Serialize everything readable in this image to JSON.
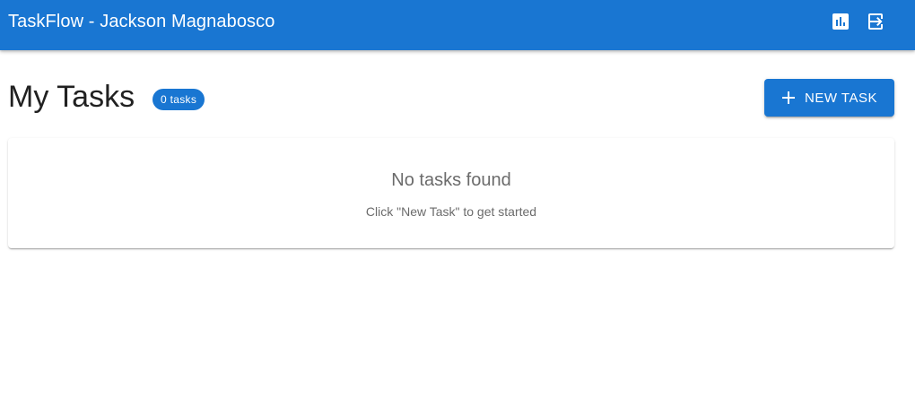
{
  "header": {
    "title": "TaskFlow - Jackson Magnabosco",
    "background": "#1976d2",
    "icons": {
      "stats": "bar-chart-icon",
      "logout": "logout-icon"
    }
  },
  "main": {
    "title": "My Tasks",
    "task_count_label": "0 tasks",
    "new_task_label": "New Task",
    "empty_state": {
      "title": "No tasks found",
      "subtitle": "Click \"New Task\" to get started"
    }
  },
  "colors": {
    "primary": "#1976d2",
    "muted_text": "#6b6b6b"
  }
}
